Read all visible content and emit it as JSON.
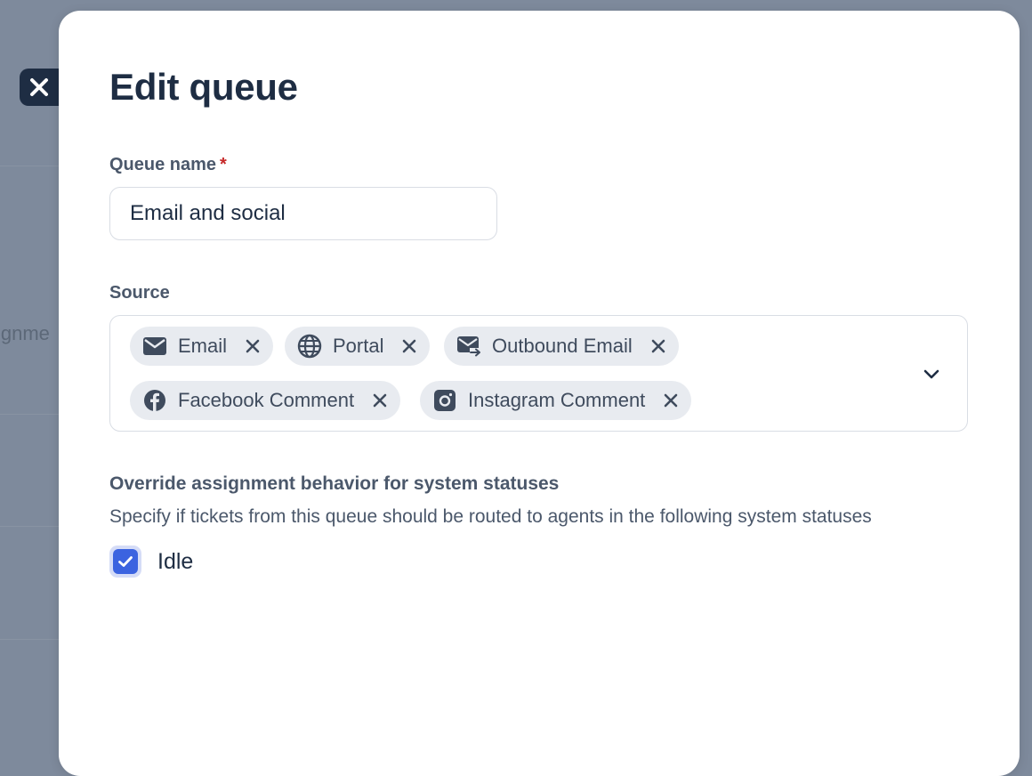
{
  "backdrop": {
    "partial_text": "ignme"
  },
  "modal": {
    "title": "Edit queue",
    "queue_name": {
      "label": "Queue name",
      "required_marker": "*",
      "value": "Email and social"
    },
    "source": {
      "label": "Source",
      "chips": [
        {
          "label": "Email",
          "icon": "envelope-icon"
        },
        {
          "label": "Portal",
          "icon": "globe-icon"
        },
        {
          "label": "Outbound Email",
          "icon": "outbound-email-icon"
        },
        {
          "label": "Facebook Comment",
          "icon": "facebook-icon"
        },
        {
          "label": "Instagram Comment",
          "icon": "instagram-icon"
        }
      ]
    },
    "override": {
      "title": "Override assignment behavior for system statuses",
      "description": "Specify if tickets from this queue should be routed to agents in the following system statuses",
      "options": [
        {
          "label": "Idle",
          "checked": true
        }
      ]
    }
  },
  "colors": {
    "overlay": "#7e8a9c",
    "text_dark": "#1e2d43",
    "text_muted": "#4b586b",
    "chip_bg": "#e8ebf0",
    "checkbox_accent": "#3b63e0",
    "required": "#c62828"
  }
}
